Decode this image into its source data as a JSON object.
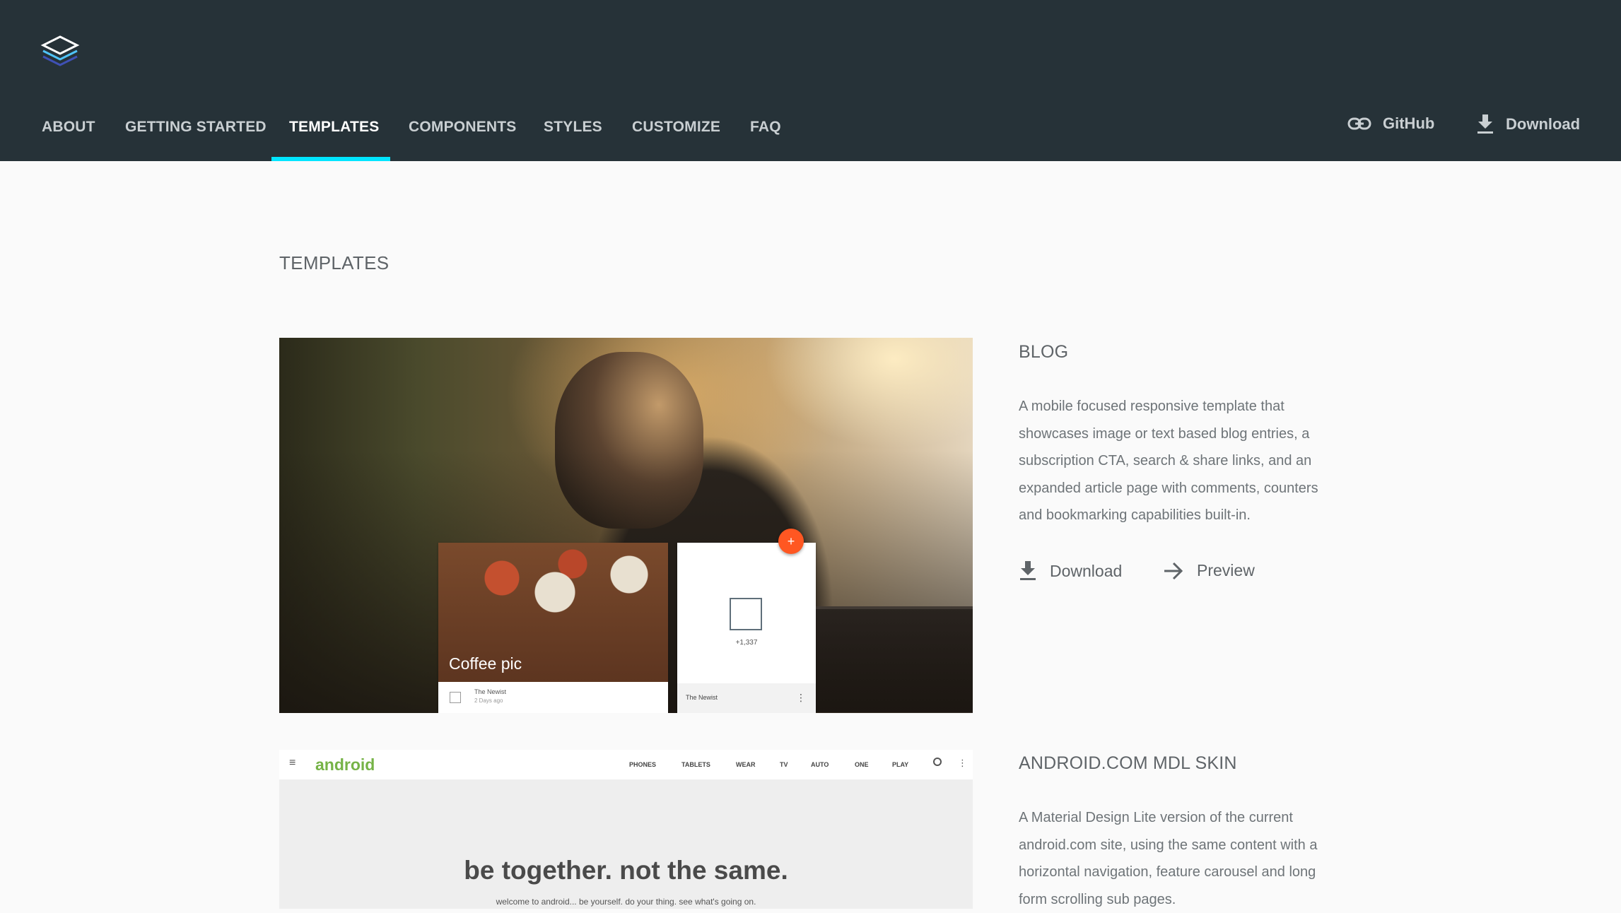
{
  "header": {
    "nav": [
      {
        "label": "ABOUT",
        "active": false
      },
      {
        "label": "GETTING STARTED",
        "active": false
      },
      {
        "label": "TEMPLATES",
        "active": true
      },
      {
        "label": "COMPONENTS",
        "active": false
      },
      {
        "label": "STYLES",
        "active": false
      },
      {
        "label": "CUSTOMIZE",
        "active": false
      },
      {
        "label": "FAQ",
        "active": false
      }
    ],
    "github_label": "GitHub",
    "download_label": "Download",
    "accent_color": "#00e5ff",
    "background_color": "#263238"
  },
  "page": {
    "title": "TEMPLATES"
  },
  "templates": [
    {
      "name": "BLOG",
      "description": "A mobile focused responsive template that showcases image or text based blog entries, a subscription CTA, search & share links, and an expanded article page with comments, counters and bookmarking capabilities built-in.",
      "download_label": "Download",
      "preview_label": "Preview",
      "preview": {
        "coffee_title": "Coffee pic",
        "coffee_author": "The Newist",
        "coffee_time": "2 Days ago",
        "newist_count": "+1,337",
        "newist_footer": "The Newist",
        "fab_symbol": "+"
      }
    },
    {
      "name": "ANDROID.COM MDL SKIN",
      "description": "A Material Design Lite version of the current android.com site, using the same content with a horizontal navigation, feature carousel and long form scrolling sub pages.",
      "preview": {
        "brand": "android",
        "nav": [
          "PHONES",
          "TABLETS",
          "WEAR",
          "TV",
          "AUTO",
          "ONE",
          "PLAY"
        ],
        "headline": "be together. not the same.",
        "subline": "welcome to android... be yourself. do your thing. see what's going on."
      }
    }
  ]
}
